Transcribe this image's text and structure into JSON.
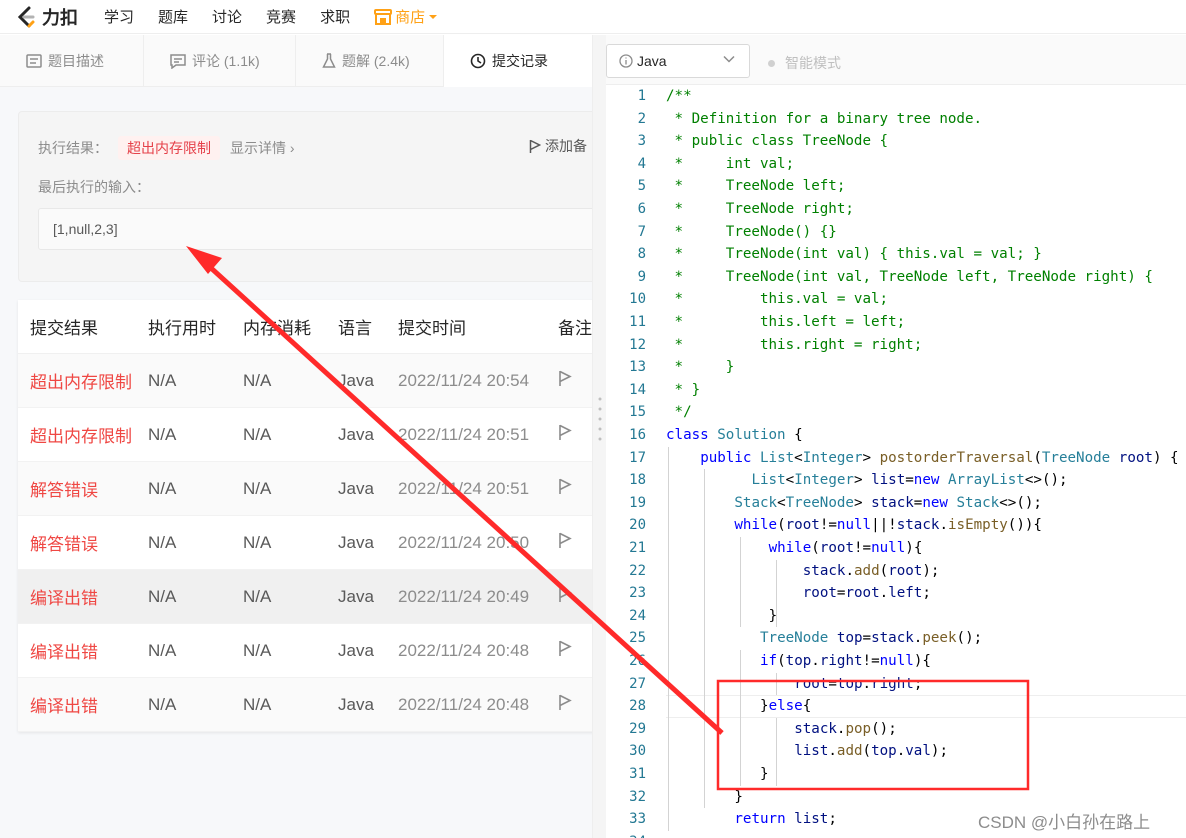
{
  "nav": {
    "logo_text": "力扣",
    "items": [
      "学习",
      "题库",
      "讨论",
      "竞赛",
      "求职"
    ],
    "shop": "商店"
  },
  "tabs": [
    {
      "label": "题目描述"
    },
    {
      "label": "评论 (1.1k)"
    },
    {
      "label": "题解 (2.4k)"
    },
    {
      "label": "提交记录"
    }
  ],
  "result": {
    "label": "执行结果：",
    "status": "超出内存限制",
    "detail": "显示详情 ›",
    "add_note": "添加备",
    "input_label": "最后执行的输入：",
    "input_value": "[1,null,2,3]"
  },
  "table": {
    "headers": [
      "提交结果",
      "执行用时",
      "内存消耗",
      "语言",
      "提交时间",
      "备注"
    ],
    "rows": [
      {
        "result": "超出内存限制",
        "time": "N/A",
        "memory": "N/A",
        "lang": "Java",
        "date": "2022/11/24 20:54"
      },
      {
        "result": "超出内存限制",
        "time": "N/A",
        "memory": "N/A",
        "lang": "Java",
        "date": "2022/11/24 20:51"
      },
      {
        "result": "解答错误",
        "time": "N/A",
        "memory": "N/A",
        "lang": "Java",
        "date": "2022/11/24 20:51"
      },
      {
        "result": "解答错误",
        "time": "N/A",
        "memory": "N/A",
        "lang": "Java",
        "date": "2022/11/24 20:50"
      },
      {
        "result": "编译出错",
        "time": "N/A",
        "memory": "N/A",
        "lang": "Java",
        "date": "2022/11/24 20:49"
      },
      {
        "result": "编译出错",
        "time": "N/A",
        "memory": "N/A",
        "lang": "Java",
        "date": "2022/11/24 20:48"
      },
      {
        "result": "编译出错",
        "time": "N/A",
        "memory": "N/A",
        "lang": "Java",
        "date": "2022/11/24 20:48"
      }
    ]
  },
  "editor": {
    "language": "Java",
    "smart_mode": "智能模式",
    "lines": [
      "/**",
      " * Definition for a binary tree node.",
      " * public class TreeNode {",
      " *     int val;",
      " *     TreeNode left;",
      " *     TreeNode right;",
      " *     TreeNode() {}",
      " *     TreeNode(int val) { this.val = val; }",
      " *     TreeNode(int val, TreeNode left, TreeNode right) {",
      " *         this.val = val;",
      " *         this.left = left;",
      " *         this.right = right;",
      " *     }",
      " * }",
      " */",
      "class Solution {",
      "    public List<Integer> postorderTraversal(TreeNode root) {",
      "          List<Integer> list=new ArrayList<>();",
      "        Stack<TreeNode> stack=new Stack<>();",
      "        while(root!=null||!stack.isEmpty()){",
      "            while(root!=null){",
      "                stack.add(root);",
      "                root=root.left;",
      "            }",
      "           TreeNode top=stack.peek();",
      "           if(top.right!=null){",
      "               root=top.right;",
      "           }else{",
      "               stack.pop();",
      "               list.add(top.val);",
      "           }",
      "        }",
      "        return list;",
      ""
    ]
  },
  "watermark": "CSDN @小白孙在路上",
  "colors": {
    "accent": "#ffa116",
    "error": "#ef4743",
    "annotation": "#ff2a2a"
  }
}
